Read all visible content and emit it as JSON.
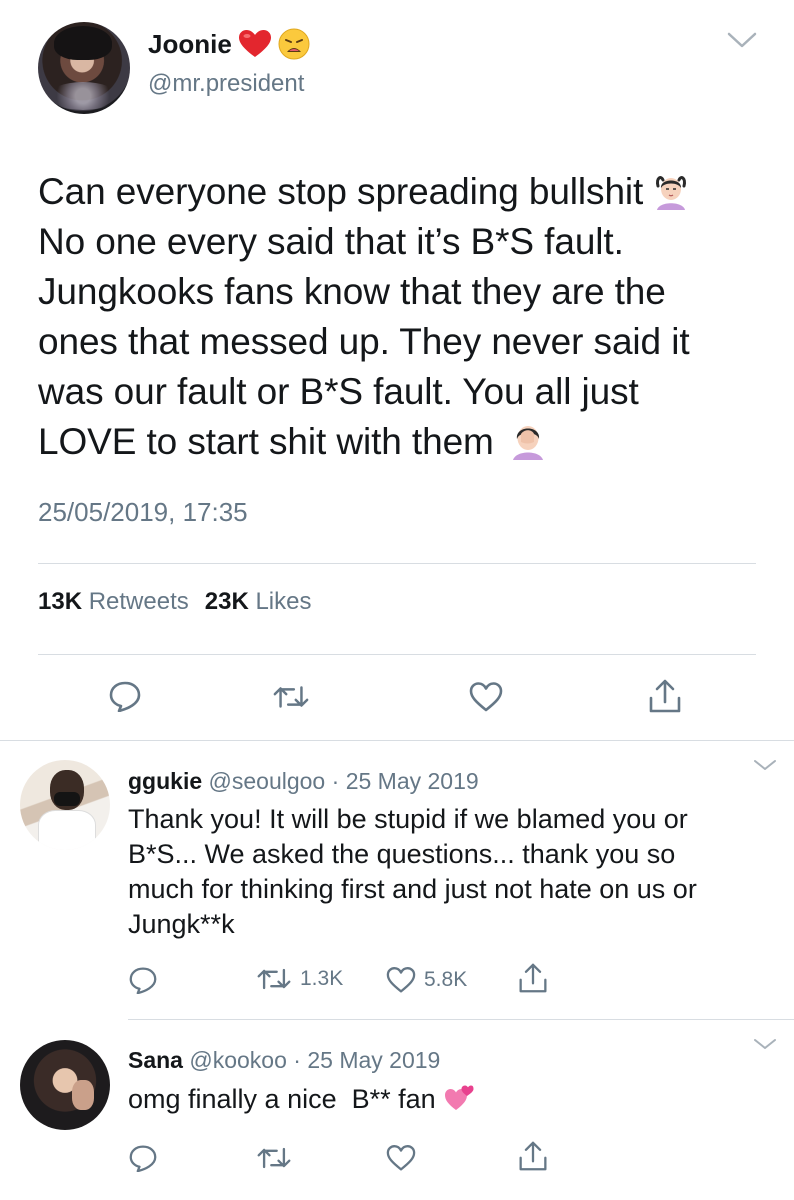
{
  "main_tweet": {
    "display_name": "Joonie",
    "name_emojis": [
      "red-heart-emoji",
      "weary-face-emoji"
    ],
    "handle": "@mr.president",
    "text_lines": [
      "Can everyone stop spreading bullshit",
      "No one every said that it’s B*S fault.",
      "Jungkooks fans know that they are the",
      "ones that messed up. They never said it",
      "was our fault or B*S fault. You all just",
      "LOVE to start shit with them"
    ],
    "timestamp": "25/05/2019, 17:35",
    "retweets_count": "13K",
    "retweets_label": "Retweets",
    "likes_count": "23K",
    "likes_label": "Likes"
  },
  "replies": [
    {
      "display_name": "ggukie",
      "handle": "@seoulgoo",
      "separator": "·",
      "date": "25 May 2019",
      "text_lines": [
        "Thank you! It will be stupid if we blamed you or",
        "B*S... We asked the questions... thank you so",
        "much for thinking first and just not hate on us or",
        "Jungk**k"
      ],
      "retweet_count": "1.3K",
      "like_count": "5.8K"
    },
    {
      "display_name": "Sana",
      "handle": "@kookoo",
      "separator": "·",
      "date": "25 May 2019",
      "text": "omg finally a nice  B** fan",
      "text_emoji": "revolving-hearts-emoji"
    }
  ],
  "colors": {
    "text": "#14171a",
    "secondary_text": "#657786",
    "divider": "#d8dde2",
    "icon": "#657786",
    "heart_red": "#e0245e"
  }
}
